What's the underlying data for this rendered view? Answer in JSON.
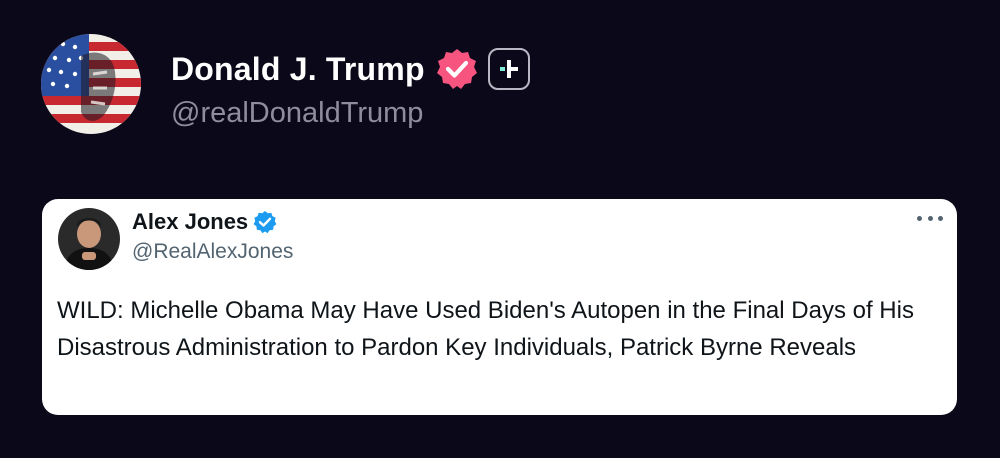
{
  "main_post": {
    "author_name": "Donald J. Trump",
    "author_handle": "@realDonaldTrump",
    "verified_color": "#f7557f",
    "icons": [
      "flag-portrait-avatar",
      "verified-badge-icon",
      "plus-badge-icon"
    ]
  },
  "quoted_post": {
    "author_name": "Alex Jones",
    "author_handle": "@RealAlexJones",
    "verified_color": "#1d9bf0",
    "text": "WILD: Michelle Obama May Have Used Biden's Autopen in the Final Days of His Disastrous Administration to Pardon Key Individuals, Patrick Byrne Reveals",
    "icons": [
      "avatar",
      "verified-badge-icon",
      "more-options-icon"
    ]
  },
  "colors": {
    "background": "#0b0819",
    "card_background": "#ffffff",
    "plus_accent": "#7ee8d6"
  }
}
